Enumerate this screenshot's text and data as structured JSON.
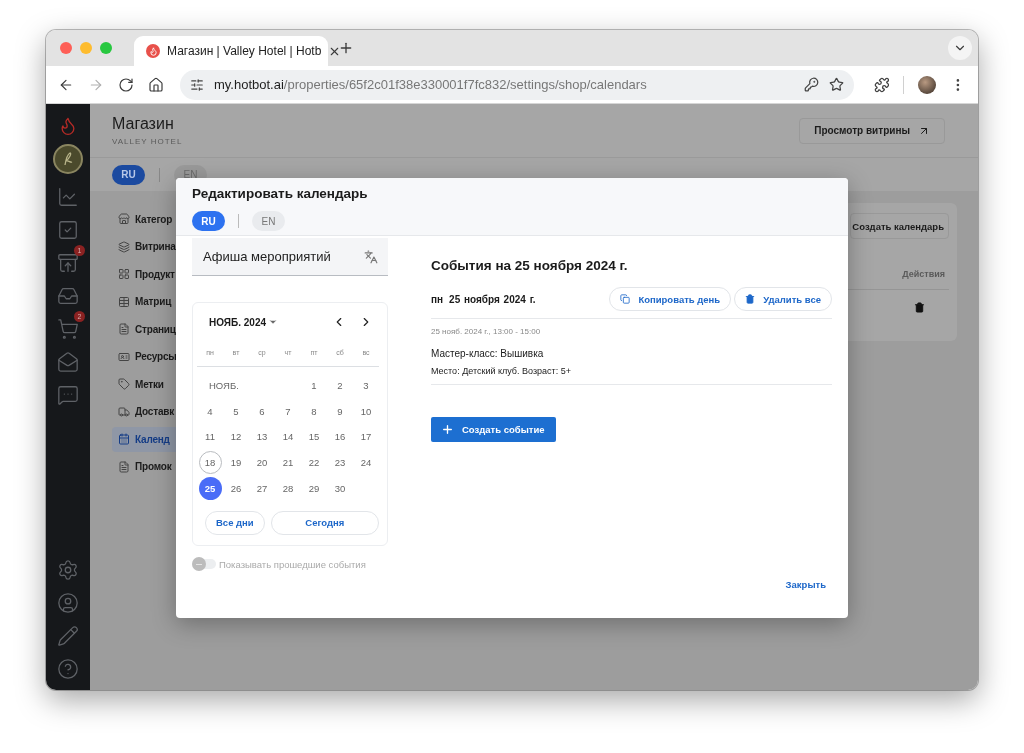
{
  "browser": {
    "tab": {
      "title": "Магазин | Valley Hotel | Hotb"
    },
    "nav_buttons": [
      {
        "kind": "back",
        "disabled": false
      },
      {
        "kind": "forward",
        "disabled": true
      },
      {
        "kind": "reload",
        "disabled": false
      },
      {
        "kind": "home",
        "disabled": false
      }
    ],
    "url": {
      "host": "my.hotbot.ai",
      "path": "/properties/65f2c01f38e330001f7fc832/settings/shop/calendars"
    }
  },
  "sidebar": {
    "items": [
      {
        "kind": "chart"
      },
      {
        "kind": "check"
      },
      {
        "kind": "inbox",
        "badge": "1"
      },
      {
        "kind": "star-tray"
      },
      {
        "kind": "cart",
        "badge": "2"
      },
      {
        "kind": "mail"
      },
      {
        "kind": "chat"
      }
    ],
    "bottom_items": [
      {
        "kind": "settings"
      },
      {
        "kind": "user"
      },
      {
        "kind": "pencil"
      },
      {
        "kind": "help"
      }
    ]
  },
  "page": {
    "title": "Магазин",
    "subtitle": "VALLEY HOTEL",
    "view_button": "Просмотр витрины",
    "languages": [
      {
        "label": "RU",
        "selected": true
      },
      {
        "label": "EN",
        "selected": false
      }
    ],
    "nav": [
      {
        "label": "Категор",
        "kind": "store",
        "selected": false
      },
      {
        "label": "Витрина",
        "kind": "cards",
        "selected": false
      },
      {
        "label": "Продукт",
        "kind": "grid",
        "selected": false
      },
      {
        "label": "Матриц",
        "kind": "table",
        "selected": false
      },
      {
        "label": "Страниц",
        "kind": "page",
        "selected": false
      },
      {
        "label": "Ресурсы",
        "kind": "resource",
        "selected": false
      },
      {
        "label": "Метки",
        "kind": "tag",
        "selected": false
      },
      {
        "label": "Доставк",
        "kind": "truck",
        "selected": false
      },
      {
        "label": "Календ",
        "kind": "calendar",
        "selected": true
      },
      {
        "label": "Промок",
        "kind": "page",
        "selected": false
      }
    ],
    "card": {
      "create_button": "Создать календарь",
      "column_header": "Действия"
    }
  },
  "modal": {
    "title": "Редактировать календарь",
    "languages": [
      {
        "label": "RU",
        "selected": true
      },
      {
        "label": "EN",
        "selected": false
      }
    ],
    "name_field": {
      "value": "Афиша мероприятий"
    },
    "calendar": {
      "month_label": "НОЯБ. 2024",
      "weekdays": [
        "пн",
        "вт",
        "ср",
        "чт",
        "пт",
        "сб",
        "вс"
      ],
      "leading_label": "НОЯБ.",
      "days": [
        {
          "label": "1",
          "selected": false,
          "today": false
        },
        {
          "label": "2",
          "selected": false,
          "today": false
        },
        {
          "label": "3",
          "selected": false,
          "today": false
        },
        {
          "label": "4",
          "selected": false,
          "today": false
        },
        {
          "label": "5",
          "selected": false,
          "today": false
        },
        {
          "label": "6",
          "selected": false,
          "today": false
        },
        {
          "label": "7",
          "selected": false,
          "today": false
        },
        {
          "label": "8",
          "selected": false,
          "today": false
        },
        {
          "label": "9",
          "selected": false,
          "today": false
        },
        {
          "label": "10",
          "selected": false,
          "today": false
        },
        {
          "label": "11",
          "selected": false,
          "today": false
        },
        {
          "label": "12",
          "selected": false,
          "today": false
        },
        {
          "label": "13",
          "selected": false,
          "today": false
        },
        {
          "label": "14",
          "selected": false,
          "today": false
        },
        {
          "label": "15",
          "selected": false,
          "today": false
        },
        {
          "label": "16",
          "selected": false,
          "today": false
        },
        {
          "label": "17",
          "selected": false,
          "today": false
        },
        {
          "label": "18",
          "selected": false,
          "today": true
        },
        {
          "label": "19",
          "selected": false,
          "today": false
        },
        {
          "label": "20",
          "selected": false,
          "today": false
        },
        {
          "label": "21",
          "selected": false,
          "today": false
        },
        {
          "label": "22",
          "selected": false,
          "today": false
        },
        {
          "label": "23",
          "selected": false,
          "today": false
        },
        {
          "label": "24",
          "selected": false,
          "today": false
        },
        {
          "label": "25",
          "selected": true,
          "today": false
        },
        {
          "label": "26",
          "selected": false,
          "today": false
        },
        {
          "label": "27",
          "selected": false,
          "today": false
        },
        {
          "label": "28",
          "selected": false,
          "today": false
        },
        {
          "label": "29",
          "selected": false,
          "today": false
        },
        {
          "label": "30",
          "selected": false,
          "today": false
        }
      ],
      "all_days_button": "Все дни",
      "today_button": "Сегодня"
    },
    "show_past": {
      "label": "Показывать прошедшие события",
      "on": false
    },
    "day_panel": {
      "heading": "События на 25 ноября 2024 г.",
      "weekday": "пн",
      "date": "25 ноября 2024 г.",
      "copy_button": "Копировать день",
      "delete_button": "Удалить все",
      "events": [
        {
          "time": "25 нояб. 2024 г., 13:00 - 15:00",
          "title": "Мастер-класс: Вышивка",
          "description": "Место: Детский клуб. Возраст: 5+"
        }
      ],
      "create_button": "Создать событие"
    },
    "close_button": "Закрыть"
  }
}
